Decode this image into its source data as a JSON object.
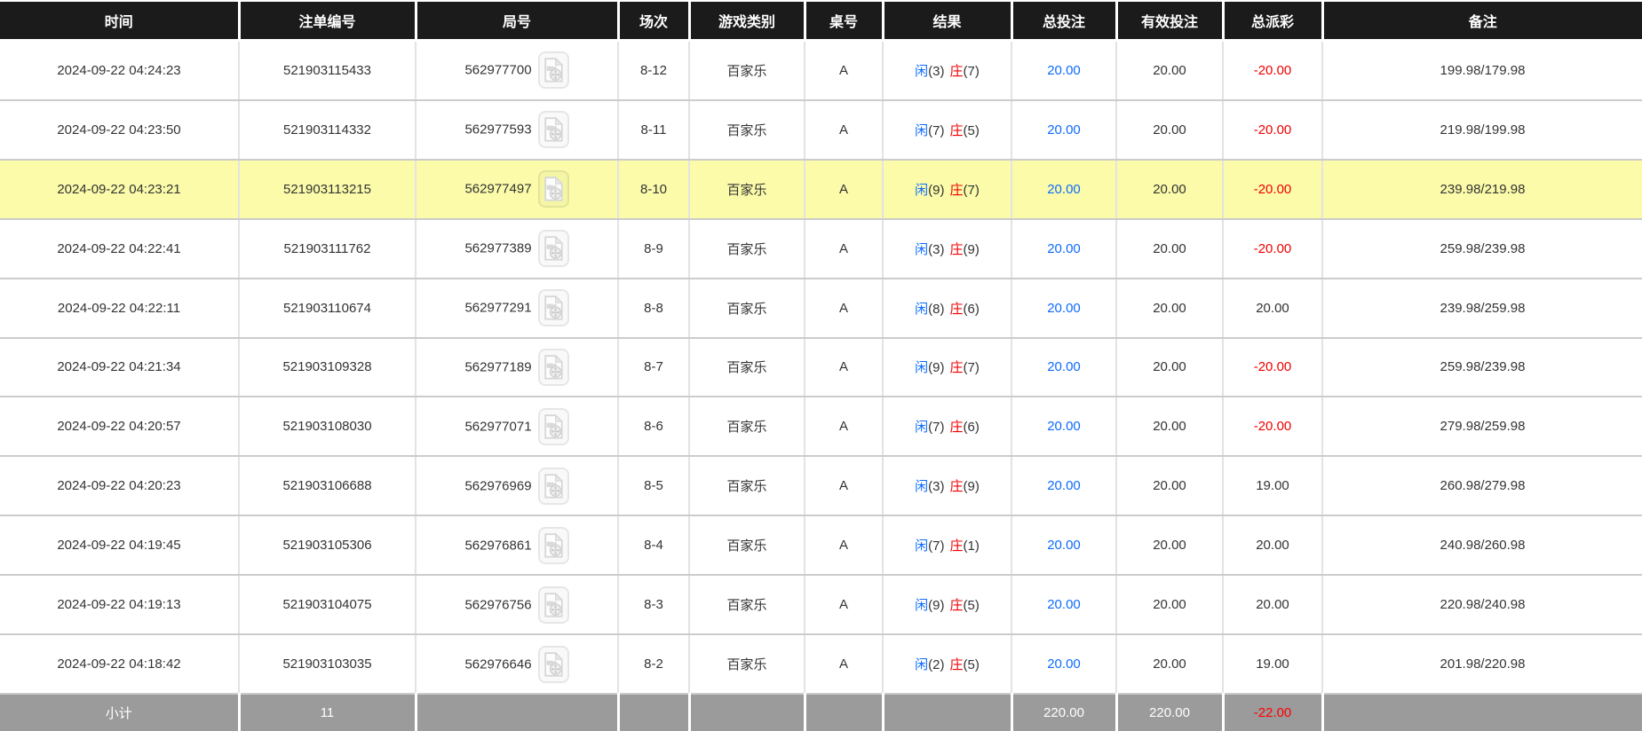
{
  "table": {
    "columns": [
      {
        "key": "time",
        "label": "时间"
      },
      {
        "key": "bet_id",
        "label": "注单编号"
      },
      {
        "key": "game_no",
        "label": "局号"
      },
      {
        "key": "session",
        "label": "场次"
      },
      {
        "key": "game_type",
        "label": "游戏类别"
      },
      {
        "key": "table_no",
        "label": "桌号"
      },
      {
        "key": "result",
        "label": "结果"
      },
      {
        "key": "total_bet",
        "label": "总投注"
      },
      {
        "key": "valid_bet",
        "label": "有效投注"
      },
      {
        "key": "payout",
        "label": "总派彩"
      },
      {
        "key": "remark",
        "label": "备注"
      }
    ],
    "rows": [
      {
        "time": "2024-09-22 04:24:23",
        "bet_id": "521903115433",
        "game_no": "562977700",
        "session": "8-12",
        "game_type": "百家乐",
        "table_no": "A",
        "result": {
          "player_label": "闲",
          "player_points": "3",
          "banker_label": "庄",
          "banker_points": "7"
        },
        "total_bet": "20.00",
        "valid_bet": "20.00",
        "payout": "-20.00",
        "remark": "199.98/179.98",
        "highlighted": false
      },
      {
        "time": "2024-09-22 04:23:50",
        "bet_id": "521903114332",
        "game_no": "562977593",
        "session": "8-11",
        "game_type": "百家乐",
        "table_no": "A",
        "result": {
          "player_label": "闲",
          "player_points": "7",
          "banker_label": "庄",
          "banker_points": "5"
        },
        "total_bet": "20.00",
        "valid_bet": "20.00",
        "payout": "-20.00",
        "remark": "219.98/199.98",
        "highlighted": false
      },
      {
        "time": "2024-09-22 04:23:21",
        "bet_id": "521903113215",
        "game_no": "562977497",
        "session": "8-10",
        "game_type": "百家乐",
        "table_no": "A",
        "result": {
          "player_label": "闲",
          "player_points": "9",
          "banker_label": "庄",
          "banker_points": "7"
        },
        "total_bet": "20.00",
        "valid_bet": "20.00",
        "payout": "-20.00",
        "remark": "239.98/219.98",
        "highlighted": true
      },
      {
        "time": "2024-09-22 04:22:41",
        "bet_id": "521903111762",
        "game_no": "562977389",
        "session": "8-9",
        "game_type": "百家乐",
        "table_no": "A",
        "result": {
          "player_label": "闲",
          "player_points": "3",
          "banker_label": "庄",
          "banker_points": "9"
        },
        "total_bet": "20.00",
        "valid_bet": "20.00",
        "payout": "-20.00",
        "remark": "259.98/239.98",
        "highlighted": false
      },
      {
        "time": "2024-09-22 04:22:11",
        "bet_id": "521903110674",
        "game_no": "562977291",
        "session": "8-8",
        "game_type": "百家乐",
        "table_no": "A",
        "result": {
          "player_label": "闲",
          "player_points": "8",
          "banker_label": "庄",
          "banker_points": "6"
        },
        "total_bet": "20.00",
        "valid_bet": "20.00",
        "payout": "20.00",
        "remark": "239.98/259.98",
        "highlighted": false
      },
      {
        "time": "2024-09-22 04:21:34",
        "bet_id": "521903109328",
        "game_no": "562977189",
        "session": "8-7",
        "game_type": "百家乐",
        "table_no": "A",
        "result": {
          "player_label": "闲",
          "player_points": "9",
          "banker_label": "庄",
          "banker_points": "7"
        },
        "total_bet": "20.00",
        "valid_bet": "20.00",
        "payout": "-20.00",
        "remark": "259.98/239.98",
        "highlighted": false
      },
      {
        "time": "2024-09-22 04:20:57",
        "bet_id": "521903108030",
        "game_no": "562977071",
        "session": "8-6",
        "game_type": "百家乐",
        "table_no": "A",
        "result": {
          "player_label": "闲",
          "player_points": "7",
          "banker_label": "庄",
          "banker_points": "6"
        },
        "total_bet": "20.00",
        "valid_bet": "20.00",
        "payout": "-20.00",
        "remark": "279.98/259.98",
        "highlighted": false
      },
      {
        "time": "2024-09-22 04:20:23",
        "bet_id": "521903106688",
        "game_no": "562976969",
        "session": "8-5",
        "game_type": "百家乐",
        "table_no": "A",
        "result": {
          "player_label": "闲",
          "player_points": "3",
          "banker_label": "庄",
          "banker_points": "9"
        },
        "total_bet": "20.00",
        "valid_bet": "20.00",
        "payout": "19.00",
        "remark": "260.98/279.98",
        "highlighted": false
      },
      {
        "time": "2024-09-22 04:19:45",
        "bet_id": "521903105306",
        "game_no": "562976861",
        "session": "8-4",
        "game_type": "百家乐",
        "table_no": "A",
        "result": {
          "player_label": "闲",
          "player_points": "7",
          "banker_label": "庄",
          "banker_points": "1"
        },
        "total_bet": "20.00",
        "valid_bet": "20.00",
        "payout": "20.00",
        "remark": "240.98/260.98",
        "highlighted": false
      },
      {
        "time": "2024-09-22 04:19:13",
        "bet_id": "521903104075",
        "game_no": "562976756",
        "session": "8-3",
        "game_type": "百家乐",
        "table_no": "A",
        "result": {
          "player_label": "闲",
          "player_points": "9",
          "banker_label": "庄",
          "banker_points": "5"
        },
        "total_bet": "20.00",
        "valid_bet": "20.00",
        "payout": "20.00",
        "remark": "220.98/240.98",
        "highlighted": false
      },
      {
        "time": "2024-09-22 04:18:42",
        "bet_id": "521903103035",
        "game_no": "562976646",
        "session": "8-2",
        "game_type": "百家乐",
        "table_no": "A",
        "result": {
          "player_label": "闲",
          "player_points": "2",
          "banker_label": "庄",
          "banker_points": "5"
        },
        "total_bet": "20.00",
        "valid_bet": "20.00",
        "payout": "19.00",
        "remark": "201.98/220.98",
        "highlighted": false
      }
    ],
    "footer": {
      "label": "小计",
      "bet_count": "11",
      "total_bet": "220.00",
      "valid_bet": "220.00",
      "payout": "-22.00"
    }
  },
  "icons": {
    "video_replay": "video-file-icon"
  },
  "colors": {
    "header_bg": "#1b1b1b",
    "header_text": "#ffffff",
    "row_highlight": "#fbfbaa",
    "footer_bg": "#9b9b9b",
    "footer_text": "#ffffff",
    "bet_blue": "#0d6bfb",
    "loss_red": "#f00000",
    "footer_loss_red": "#ff0000"
  }
}
